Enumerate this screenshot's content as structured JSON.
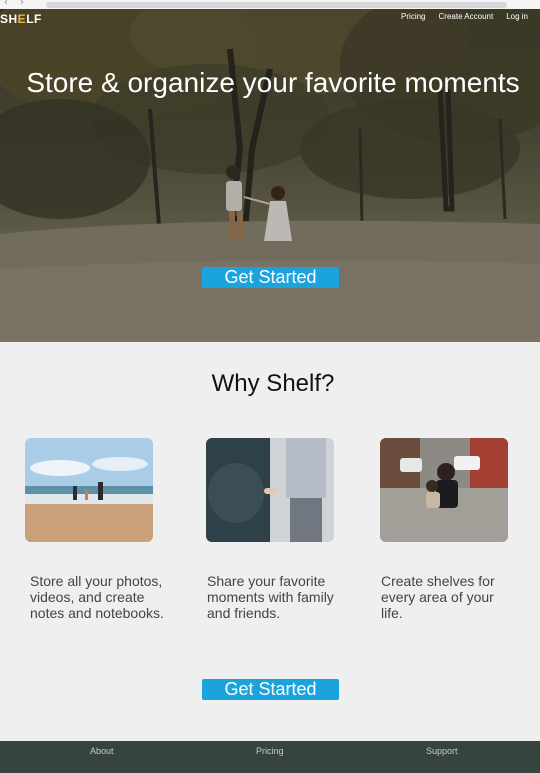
{
  "browser": {
    "back_icon": "chevron-left-icon",
    "forward_icon": "chevron-right-icon"
  },
  "header": {
    "logo_text_start": "SH",
    "logo_text_accent": "E",
    "logo_text_end": "LF",
    "nav": [
      {
        "label": "Pricing"
      },
      {
        "label": "Create Account"
      },
      {
        "label": "Log in"
      }
    ]
  },
  "hero": {
    "title": "Store & organize your favorite moments",
    "cta_label": "Get Started"
  },
  "why": {
    "title": "Why Shelf?",
    "features": [
      {
        "text": "Store all your photos, videos, and create notes and notebooks."
      },
      {
        "text": "Share your favorite moments with family and friends."
      },
      {
        "text": "Create shelves for every area of your life."
      }
    ],
    "cta_label": "Get Started"
  },
  "footer": {
    "links": [
      {
        "label": "About"
      },
      {
        "label": "Pricing"
      },
      {
        "label": "Support"
      }
    ]
  },
  "colors": {
    "accent": "#1aa3dc",
    "logo_accent": "#f2b53a",
    "footer_bg": "#36433f",
    "page_bg": "#efefef"
  }
}
